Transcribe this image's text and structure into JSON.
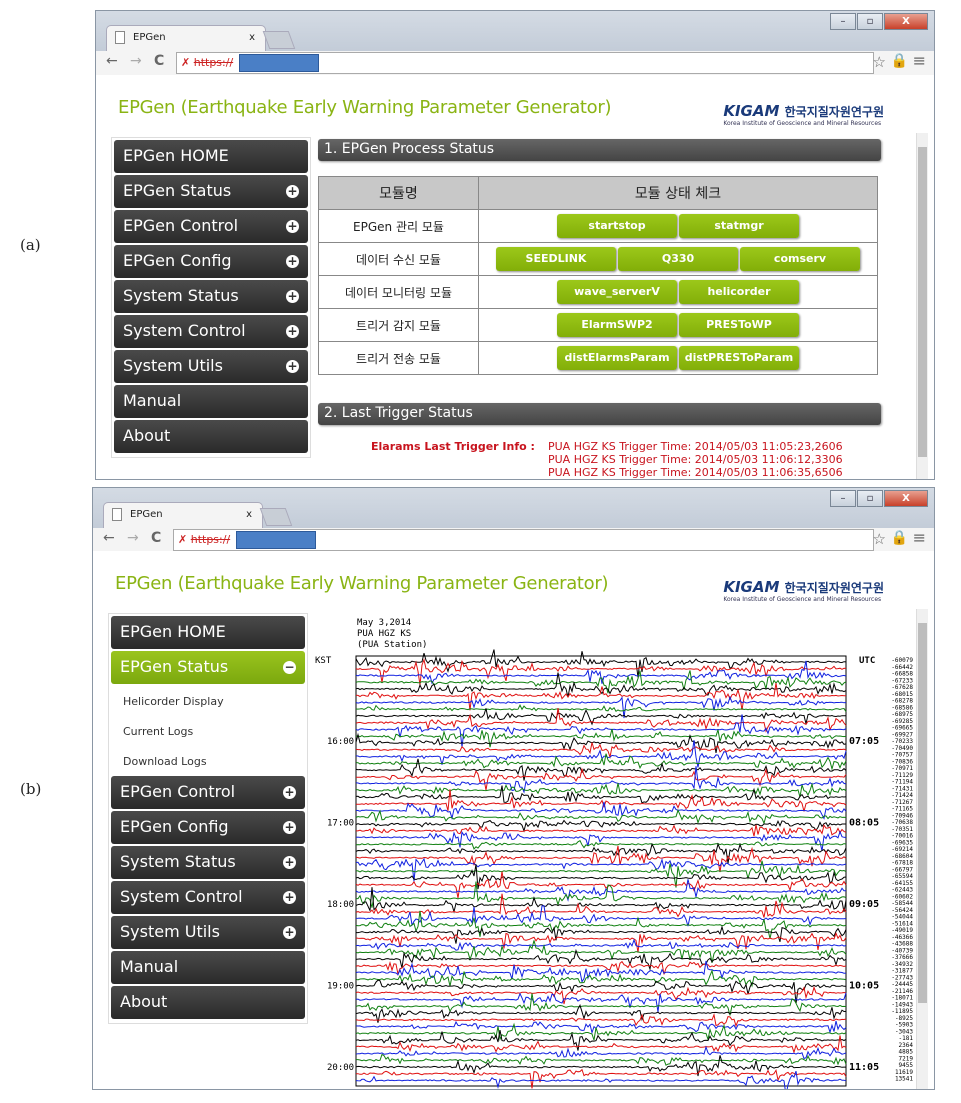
{
  "figure_labels": [
    "(a)",
    "(b)"
  ],
  "browser": {
    "tab_title": "EPGen",
    "tab_close": "x",
    "url_prefix": "https://",
    "nav": {
      "back": "←",
      "forward": "→",
      "reload": "C"
    },
    "star": "☆",
    "menu": "≡",
    "window_buttons": {
      "minimize": "–",
      "maximize": "▫",
      "close": "X"
    }
  },
  "header": {
    "title": "EPGen (Earthquake Early Warning Parameter Generator)",
    "logo": {
      "mark": "KIGAM",
      "korean": "한국지질자원연구원",
      "english": "Korea Institute of Geoscience and Mineral Resources"
    }
  },
  "accent_color": "#8ab414",
  "sidebar_a": [
    {
      "label": "EPGen HOME",
      "icon": ""
    },
    {
      "label": "EPGen Status",
      "icon": "plus"
    },
    {
      "label": "EPGen Control",
      "icon": "plus"
    },
    {
      "label": "EPGen Config",
      "icon": "plus"
    },
    {
      "label": "System Status",
      "icon": "plus"
    },
    {
      "label": "System Control",
      "icon": "plus"
    },
    {
      "label": "System Utils",
      "icon": "plus"
    },
    {
      "label": "Manual",
      "icon": ""
    },
    {
      "label": "About",
      "icon": ""
    }
  ],
  "sidebar_b": {
    "home": "EPGen HOME",
    "active": "EPGen Status",
    "submenu": [
      "Helicorder Display",
      "Current Logs",
      "Download Logs"
    ],
    "rest": [
      "EPGen Control",
      "EPGen Config",
      "System Status",
      "System Control",
      "System Utils"
    ],
    "manual": "Manual",
    "about": "About"
  },
  "process_status": {
    "heading": "1. EPGen Process Status",
    "columns": [
      "모듈명",
      "모듈 상태 체크"
    ],
    "rows": [
      {
        "name": "EPGen 관리 모듈",
        "modules": [
          "startstop",
          "statmgr"
        ]
      },
      {
        "name": "데이터 수신 모듈",
        "modules": [
          "SEEDLINK",
          "Q330",
          "comserv"
        ]
      },
      {
        "name": "데이터 모니터링 모듈",
        "modules": [
          "wave_serverV",
          "helicorder"
        ]
      },
      {
        "name": "트리거 감지 모듈",
        "modules": [
          "ElarmSWP2",
          "PRESToWP"
        ]
      },
      {
        "name": "트리거 전송 모듈",
        "modules": [
          "distElarmsParam",
          "distPRESToParam"
        ]
      }
    ]
  },
  "trigger_status": {
    "heading": "2. Last Trigger Status",
    "label": "Elarams Last Trigger Info :",
    "entries": [
      "PUA HGZ KS Trigger Time: 2014/05/03 11:05:23,2606",
      "PUA HGZ KS Trigger Time: 2014/05/03 11:06:12,3306",
      "PUA HGZ KS Trigger Time: 2014/05/03 11:06:35,6506"
    ]
  },
  "helicorder": {
    "date": "May 3,2014",
    "channel": "PUA HGZ KS",
    "station": "(PUA Station)",
    "left_zone": "KST",
    "right_zone": "UTC",
    "left_times": [
      "16:00",
      "17:00",
      "18:00",
      "19:00",
      "20:00"
    ],
    "right_times": [
      "07:05",
      "08:05",
      "09:05",
      "10:05",
      "11:05"
    ],
    "trace_colors": [
      "#000000",
      "#e01010",
      "#1020e0",
      "#108010"
    ],
    "offsets": [
      "-60079",
      "-66442",
      "-66858",
      "-67233",
      "-67628",
      "-68015",
      "-68278",
      "-68586",
      "-68975",
      "-69285",
      "-69665",
      "-69927",
      "-70233",
      "-70490",
      "-70757",
      "-70836",
      "-70971",
      "-71129",
      "-71194",
      "-71431",
      "-71424",
      "-71267",
      "-71165",
      "-70946",
      "-70638",
      "-70351",
      "-70016",
      "-69635",
      "-69214",
      "-68604",
      "-67818",
      "-66797",
      "-65594",
      "-64155",
      "-62443",
      "-60602",
      "-58544",
      "-56424",
      "-54044",
      "-51614",
      "-49019",
      "-46366",
      "-43688",
      "-40739",
      "-37666",
      "-34932",
      "-31877",
      "-27743",
      "-24445",
      "-21146",
      "-18071",
      "-14943",
      "-11895",
      "-8925",
      "-5903",
      "-3043",
      "-181",
      "2364",
      "4885",
      "7219",
      "9455",
      "11619",
      "13541"
    ]
  }
}
